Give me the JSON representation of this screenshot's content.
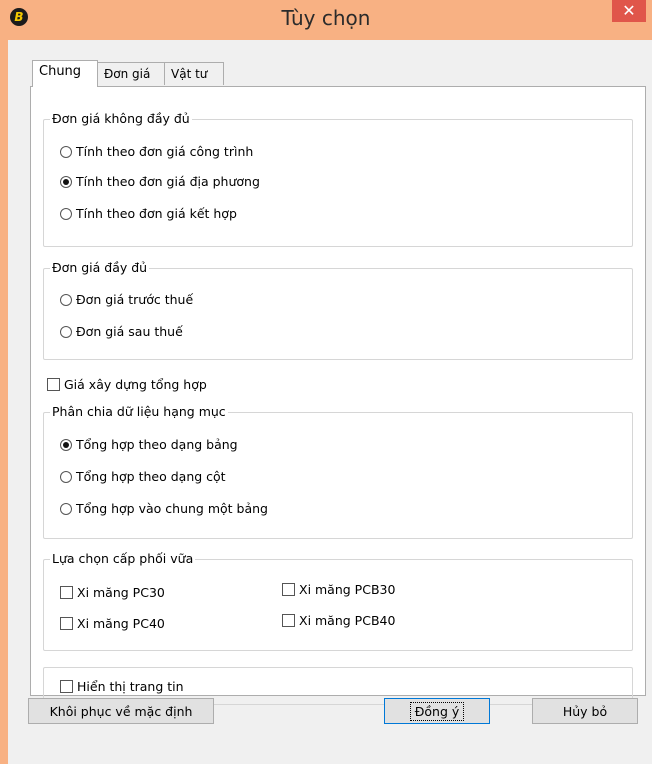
{
  "window": {
    "title": "Tùy chọn",
    "close_glyph": "✕",
    "app_icon_glyph": "B"
  },
  "tabs": [
    {
      "label": "Chung",
      "active": true
    },
    {
      "label": "Đơn giá",
      "active": false
    },
    {
      "label": "Vật tư",
      "active": false
    }
  ],
  "groups": {
    "incomplete": {
      "legend": "Đơn giá không đầy đủ",
      "options": [
        {
          "label": "Tính theo đơn giá công trình",
          "checked": false
        },
        {
          "label": "Tính theo đơn giá địa phương",
          "checked": true
        },
        {
          "label": "Tính theo đơn giá kết hợp",
          "checked": false
        }
      ]
    },
    "complete": {
      "legend": "Đơn giá đầy đủ",
      "options": [
        {
          "label": "Đơn giá trước thuế",
          "checked": false
        },
        {
          "label": "Đơn giá sau thuế",
          "checked": false
        }
      ]
    },
    "composite_price": {
      "label": "Giá xây dựng tổng hợp",
      "checked": false
    },
    "split": {
      "legend": "Phân chia dữ liệu hạng mục",
      "options": [
        {
          "label": "Tổng hợp theo dạng bảng",
          "checked": true
        },
        {
          "label": "Tổng hợp theo dạng cột",
          "checked": false
        },
        {
          "label": "Tổng hợp vào chung một  bảng",
          "checked": false
        }
      ]
    },
    "mortar": {
      "legend": "Lựa chọn cấp phối vữa",
      "options": [
        {
          "label": "Xi măng PC30",
          "checked": false
        },
        {
          "label": "Xi măng PCB30",
          "checked": false
        },
        {
          "label": "Xi măng PC40",
          "checked": false
        },
        {
          "label": "Xi măng PCB40",
          "checked": false
        }
      ]
    },
    "show_info": {
      "label": "Hiển thị trang tin",
      "checked": false
    }
  },
  "buttons": {
    "restore": "Khôi phục về mặc định",
    "ok": "Đồng ý",
    "cancel": "Hủy bỏ"
  },
  "colors": {
    "titlebar": "#f8b183",
    "close": "#e0564a",
    "dialog_bg": "#f0f0f0"
  }
}
